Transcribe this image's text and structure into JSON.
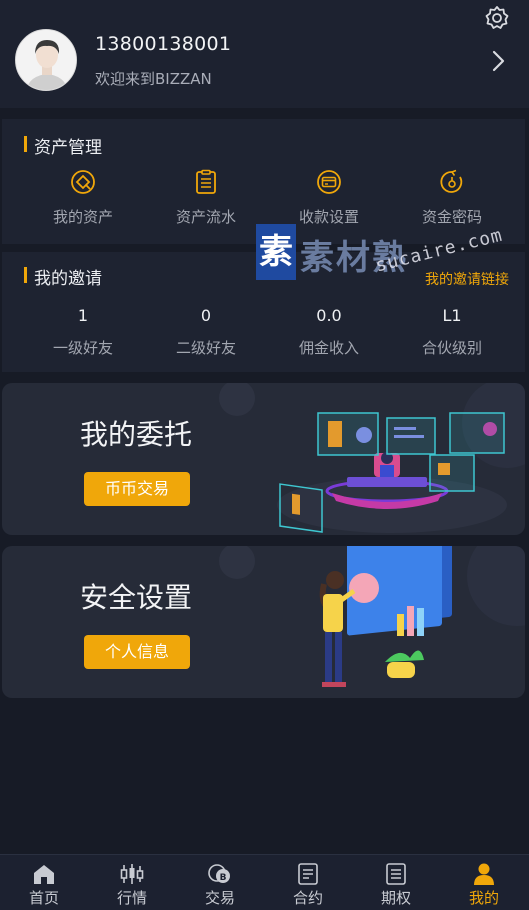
{
  "profile": {
    "phone": "13800138001",
    "welcome": "欢迎来到BIZZAN",
    "settings_icon": "gear-icon",
    "chevron_icon": "chevron-right-icon"
  },
  "assets": {
    "title": "资产管理",
    "items": [
      {
        "label": "我的资产",
        "icon": "asset-icon"
      },
      {
        "label": "资产流水",
        "icon": "clipboard-icon"
      },
      {
        "label": "收款设置",
        "icon": "card-icon"
      },
      {
        "label": "资金密码",
        "icon": "password-icon"
      }
    ]
  },
  "invite": {
    "title": "我的邀请",
    "link_label": "我的邀请链接",
    "stats": [
      {
        "value": "1",
        "label": "一级好友"
      },
      {
        "value": "0",
        "label": "二级好友"
      },
      {
        "value": "0.0",
        "label": "佣金收入"
      },
      {
        "value": "L1",
        "label": "合伙级别"
      }
    ]
  },
  "banners": {
    "orders": {
      "title": "我的委托",
      "button": "币币交易"
    },
    "security": {
      "title": "安全设置",
      "button": "个人信息"
    }
  },
  "watermark": {
    "brand": "素材熟",
    "box_char": "素",
    "url": "sucaire.com"
  },
  "tabs": [
    {
      "label": "首页",
      "icon": "home-icon"
    },
    {
      "label": "行情",
      "icon": "candlestick-icon"
    },
    {
      "label": "交易",
      "icon": "exchange-icon"
    },
    {
      "label": "合约",
      "icon": "contract-icon"
    },
    {
      "label": "期权",
      "icon": "options-icon"
    },
    {
      "label": "我的",
      "icon": "user-icon",
      "active": true
    }
  ],
  "colors": {
    "accent": "#f0a70a",
    "background": "#171b26",
    "card": "#1e2331",
    "banner": "#262b38"
  }
}
